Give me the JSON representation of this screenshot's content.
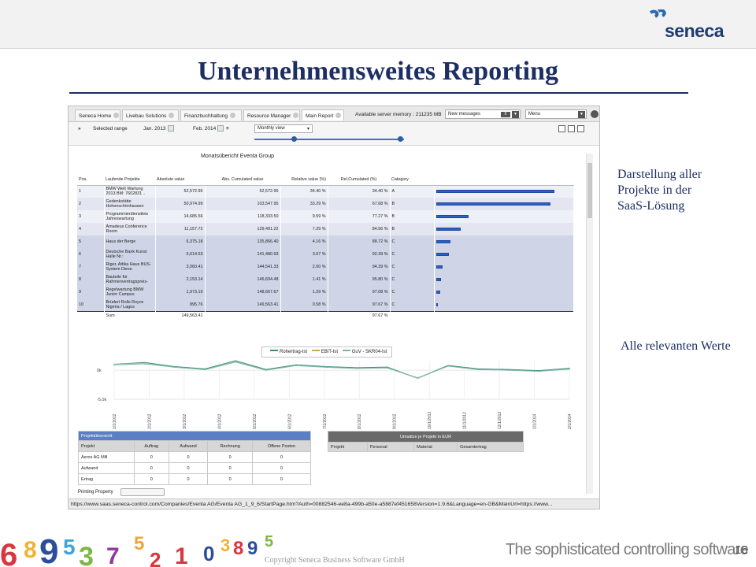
{
  "slide": {
    "title": "Unternehmensweites Reporting",
    "note1": "Darstellung aller Projekte in der SaaS-Lösung",
    "note2": "Alle relevanten Werte",
    "copyright": "Copyright Seneca Business Software GmbH",
    "tagline": "The sophisticated controlling software",
    "page": "16",
    "logo_text": "seneca"
  },
  "app": {
    "tabs": [
      {
        "label": "Seneca Home"
      },
      {
        "label": "Livebau Solutions"
      },
      {
        "label": "Finanzbuchhaltung"
      },
      {
        "label": "Resource Manager"
      },
      {
        "label": "Main Report"
      }
    ],
    "memory": "Available server memory : 211235 MB",
    "messages": "New messages",
    "messages_count": "0",
    "menu": "Menu",
    "toolbar": {
      "selected_range_label": "Selected range",
      "from": "Jan. 2013",
      "to": "Feb. 2014",
      "view": "Monthly view"
    },
    "report_title": "Monatsübericht Eventa Group",
    "columns": [
      "Pos.",
      "Laufende Projekte",
      "Absolute value",
      "Abs. Cumulated value",
      "Relative value (%)",
      "Rel.Cumulated (%)",
      "Category"
    ],
    "rows": [
      {
        "pos": "1",
        "name": "BMW Welt Wartung 2013 BM: 7602831 ..",
        "abs": "52,572.95",
        "cum": "52,572.95",
        "rel": "34.40 %",
        "relcum": "34.40 %",
        "cat": "A",
        "share": 34.4
      },
      {
        "pos": "2",
        "name": "Gedenkstätte Hohenschönhausen",
        "abs": "50,974.99",
        "cum": "103,547.95",
        "rel": "33.29 %",
        "relcum": "67.68 %",
        "cat": "B",
        "share": 33.29
      },
      {
        "pos": "3",
        "name": "Programmierdienstleis Jahreswartung",
        "abs": "14,685.56",
        "cum": "118,333.50",
        "rel": "9.59 %",
        "relcum": "77.27 %",
        "cat": "B",
        "share": 9.59
      },
      {
        "pos": "4",
        "name": "Amadeus Conference Room",
        "abs": "11,157.72",
        "cum": "129,491.22",
        "rel": "7.29 %",
        "relcum": "84.56 %",
        "cat": "B",
        "share": 7.29
      },
      {
        "pos": "5",
        "name": "Haus der Berge",
        "abs": "6,375.18",
        "cum": "135,866.40",
        "rel": "4.16 %",
        "relcum": "88.72 %",
        "cat": "C",
        "share": 4.16
      },
      {
        "pos": "6",
        "name": "Deutsche Bank Kunst Halle Nr.:",
        "abs": "5,614.53",
        "cum": "141,480.93",
        "rel": "3.67 %",
        "relcum": "92.39 %",
        "cat": "C",
        "share": 3.67
      },
      {
        "pos": "7",
        "name": "Riger, Attika Haus BUS-System Diese",
        "abs": "3,060.41",
        "cum": "144,541.33",
        "rel": "2.00 %",
        "relcum": "94.39 %",
        "cat": "C",
        "share": 2.0
      },
      {
        "pos": "8",
        "name": "Bauteile für Rahmenvertragspreis-",
        "abs": "2,153.14",
        "cum": "146,694.48",
        "rel": "1.41 %",
        "relcum": "95.80 %",
        "cat": "C",
        "share": 1.41
      },
      {
        "pos": "9",
        "name": "Regelwartung BMW Junior Campus",
        "abs": "1,973.19",
        "cum": "148,667.67",
        "rel": "1.29 %",
        "relcum": "97.08 %",
        "cat": "C",
        "share": 1.29
      },
      {
        "pos": "10",
        "name": "Brüdert Rolls Royce Nigeria / Lagos",
        "abs": "895.76",
        "cum": "149,563.41",
        "rel": "0.58 %",
        "relcum": "97.67 %",
        "cat": "C",
        "share": 0.58
      }
    ],
    "sum": {
      "label": "Sum",
      "abs": "149,563.41",
      "relcum": "97.67 %"
    },
    "url": "https://www.saas.seneca-control.com/Companies/Eventa AG/Eventa AG_1_9_6/StartPage.htm?Auth=00882546-ee8a-499b-a50e-a5887ef451658Version=1.9.6&Language=en-GB&MainUrl=https://www..."
  },
  "chart_data": {
    "type": "line",
    "legend": [
      "Rohertrag-Ist",
      "EBIT-Ist",
      "GuV - SKR04-Ist"
    ],
    "colors": [
      "#3f8f80",
      "#b3d3a8",
      "#7fb6a7"
    ],
    "y_ticks": [
      "0k",
      "-5.0k"
    ],
    "ylim": [
      -5.0,
      1.5
    ],
    "categories": [
      "1/1/2012",
      "2/1/2012",
      "3/1/2012",
      "4/1/2012",
      "5/1/2012",
      "6/1/2012",
      "7/1/2012",
      "8/1/2012",
      "9/1/2012",
      "10/1/2012",
      "11/1/2012",
      "12/1/2012",
      "1/1/2013",
      "2/1/2013",
      "3/1/2013",
      "4/1/2013",
      "5/1/2013",
      "6/1/2013",
      "7/1/2013",
      "8/1/2013",
      "9/1/2013",
      "10/1/2013",
      "11/1/2013",
      "12/1/2013",
      "1/1/2014",
      "2/1/2014",
      "3/1/2014",
      "4/1/2014",
      "5/1/2014",
      "6/1/2014",
      "7/1/2014",
      "8/1/2014",
      "9/1/2014"
    ],
    "x_tick_labels": [
      "1/1/2012",
      "2/1/2012",
      "3/1/2012",
      "4/1/2012",
      "5/1/2012",
      "6/1/2012",
      "7/1/2012",
      "8/1/2012",
      "9/1/2012",
      "10/1/2012",
      "11/1/2012",
      "12/1/2012",
      "1/1/2014",
      "2/1/2014"
    ],
    "series": [
      {
        "name": "Rohertrag-Ist",
        "values": [
          1.0,
          1.3,
          0.6,
          0.2,
          1.6,
          0.1,
          0.9,
          0.6,
          0.4,
          0.5,
          -1.4,
          0.8,
          0.2,
          0.1,
          -0.1,
          0.3
        ]
      },
      {
        "name": "EBIT-Ist",
        "values": [
          1.0,
          1.2,
          0.5,
          0.1,
          1.5,
          0.0,
          0.8,
          0.5,
          0.3,
          0.4,
          -1.4,
          0.7,
          0.1,
          0.0,
          -0.2,
          0.2
        ]
      },
      {
        "name": "GuV - SKR04-Ist",
        "values": [
          0.9,
          1.1,
          0.5,
          0.1,
          1.4,
          0.0,
          0.8,
          0.5,
          0.3,
          0.4,
          -1.3,
          0.7,
          0.1,
          0.0,
          -0.2,
          0.2
        ]
      }
    ]
  },
  "projektuebersicht": {
    "title": "Projektübersicht",
    "columns": [
      "Projekt",
      "Auftrag",
      "Aufwand",
      "Rechnung",
      "Offene Posten"
    ],
    "rows": [
      {
        "name": "Aerox AG Mill",
        "values": [
          "0",
          "0",
          "0",
          "0"
        ]
      },
      {
        "name": "Aufwand",
        "values": [
          "0",
          "0",
          "0",
          "0"
        ]
      },
      {
        "name": "Ertrag",
        "values": [
          "0",
          "0",
          "0",
          "0"
        ]
      }
    ]
  },
  "umsaetze": {
    "title": "Umsätze je Projekt in EUR",
    "columns": [
      "Projekt",
      "Personal",
      "Material",
      "Gesamtertrag"
    ]
  },
  "printing": {
    "label": "Printing Property"
  }
}
